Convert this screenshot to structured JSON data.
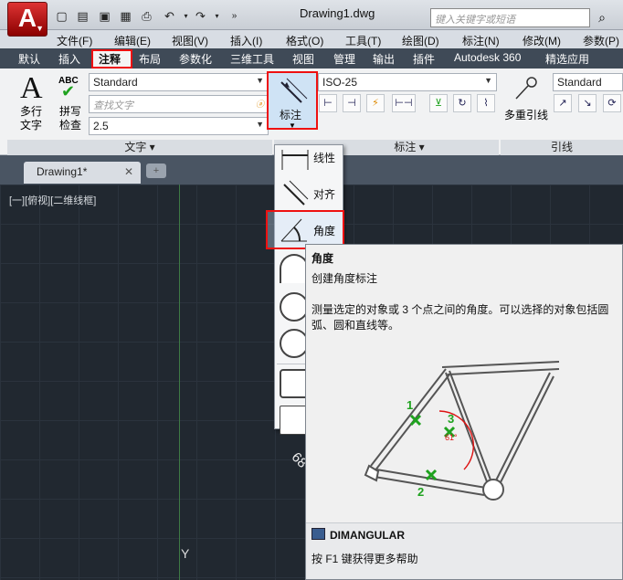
{
  "app": {
    "logo": "A",
    "document_title": "Drawing1.dwg",
    "search_placeholder": "键入关键字或短语"
  },
  "menubar": [
    "文件(F)",
    "编辑(E)",
    "视图(V)",
    "插入(I)",
    "格式(O)",
    "工具(T)",
    "绘图(D)",
    "标注(N)",
    "修改(M)",
    "参数(P)"
  ],
  "ribbon_tabs": [
    "默认",
    "插入",
    "注释",
    "布局",
    "参数化",
    "三维工具",
    "视图",
    "管理",
    "输出",
    "插件",
    "Autodesk 360",
    "精选应用"
  ],
  "active_tab": "注释",
  "text_panel": {
    "multiline_text": "多行\n文字",
    "spell_check_badge": "ABC",
    "spell_check": "拼写\n检查",
    "style_value": "Standard",
    "find_placeholder": "查找文字",
    "height_value": "2.5",
    "panel_title": "文字"
  },
  "dim_panel": {
    "button_label": "标注",
    "style_value": "ISO-25",
    "panel_title": "标注"
  },
  "leader_panel": {
    "button_label": "多重引线",
    "style_value": "Standard",
    "panel_title": "引线"
  },
  "doc_tab": {
    "title": "Drawing1*"
  },
  "viewport_label": "[一][俯视][二维线框]",
  "axis_y": "Y",
  "dropdown": {
    "items": [
      "线性",
      "对齐",
      "角度"
    ],
    "selected": "角度",
    "partial_dim_text": "68"
  },
  "tooltip": {
    "title": "角度",
    "subtitle": "创建角度标注",
    "description": "测量选定的对象或 3 个点之间的角度。可以选择的对象包括圆弧、圆和直线等。",
    "diagram_labels": [
      "1",
      "2",
      "3",
      "61°"
    ],
    "command": "DIMANGULAR",
    "help": "按 F1 键获得更多帮助"
  },
  "colors": {
    "accent_red": "#e11111",
    "marker_green": "#1fa21f",
    "canvas": "#212830"
  }
}
